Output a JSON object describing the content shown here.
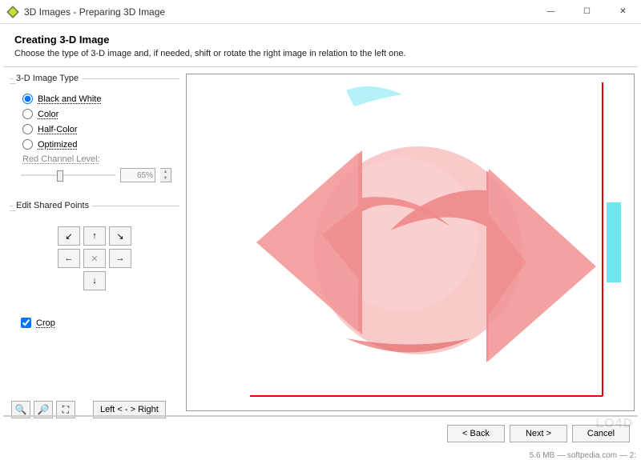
{
  "window": {
    "title": "3D Images - Preparing 3D Image",
    "min": "—",
    "max": "☐",
    "close": "✕"
  },
  "header": {
    "title": "Creating 3-D Image",
    "desc": "Choose the type of 3-D image and, if needed, shift or rotate the right image in relation to the left one."
  },
  "imageType": {
    "legend": "3-D Image Type",
    "options": [
      {
        "label": "Black and White",
        "checked": true
      },
      {
        "label": "Color",
        "checked": false
      },
      {
        "label": "Half-Color",
        "checked": false
      },
      {
        "label": "Optimized",
        "checked": false
      }
    ],
    "redLabel": "Red Channel Level:",
    "redValue": "65%"
  },
  "editPoints": {
    "legend": "Edit Shared Points",
    "arrows": {
      "nw": "↙",
      "n": "↑",
      "ne": "↘",
      "w": "←",
      "x": "✕",
      "e": "→",
      "s": "↓"
    }
  },
  "crop": {
    "label": "Crop",
    "checked": true
  },
  "tools": {
    "zoomIn": "⊕",
    "zoomOut": "⊖",
    "fit": "⛶",
    "swap": "Left < - > Right"
  },
  "footer": {
    "back": "< Back",
    "next": "Next >",
    "cancel": "Cancel"
  },
  "status": "5.6 MB — softpedia.com — 2:",
  "watermark": "LO4D"
}
